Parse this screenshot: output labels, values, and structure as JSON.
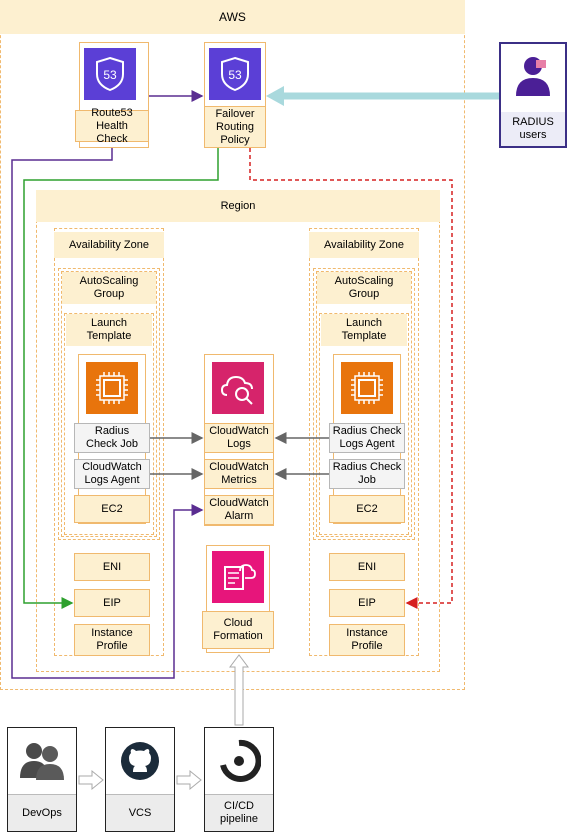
{
  "aws": {
    "label": "AWS"
  },
  "region": {
    "label": "Region"
  },
  "route53": {
    "label": "Route53 Health Check",
    "icon_text": "53"
  },
  "failover": {
    "label": "Failover Routing Policy",
    "icon_text": "53"
  },
  "radius_users": {
    "label": "RADIUS users"
  },
  "az_left": {
    "label": "Availability Zone",
    "asg": "AutoScaling Group",
    "launch": "Launch Template",
    "item1": "Radius Check Job",
    "item2": "CloudWatch Logs Agent",
    "ec2": "EC2",
    "eni": "ENI",
    "eip": "EIP",
    "profile": "Instance Profile"
  },
  "az_right": {
    "label": "Availability Zone",
    "asg": "AutoScaling Group",
    "launch": "Launch Template",
    "item1": "Radius Check Logs Agent",
    "item2": "Radius Check Job",
    "ec2": "EC2",
    "eni": "ENI",
    "eip": "EIP",
    "profile": "Instance Profile"
  },
  "cloudwatch": {
    "logs": "CloudWatch Logs",
    "metrics": "CloudWatch Metrics",
    "alarm": "CloudWatch Alarm"
  },
  "cloudformation": {
    "label": "Cloud Formation"
  },
  "pipeline": {
    "devops": "DevOps",
    "vcs": "VCS",
    "cicd": "CI/CD pipeline"
  },
  "colors": {
    "route53": "#5b3fd6",
    "ec2": "#e8740c",
    "cloudwatch": "#d6246b",
    "cloudformation": "#e7157b",
    "purple_link": "#5a2d91",
    "green_link": "#2ea02e",
    "red_link": "#d62020",
    "radius_arrow": "#a9d9dd"
  }
}
